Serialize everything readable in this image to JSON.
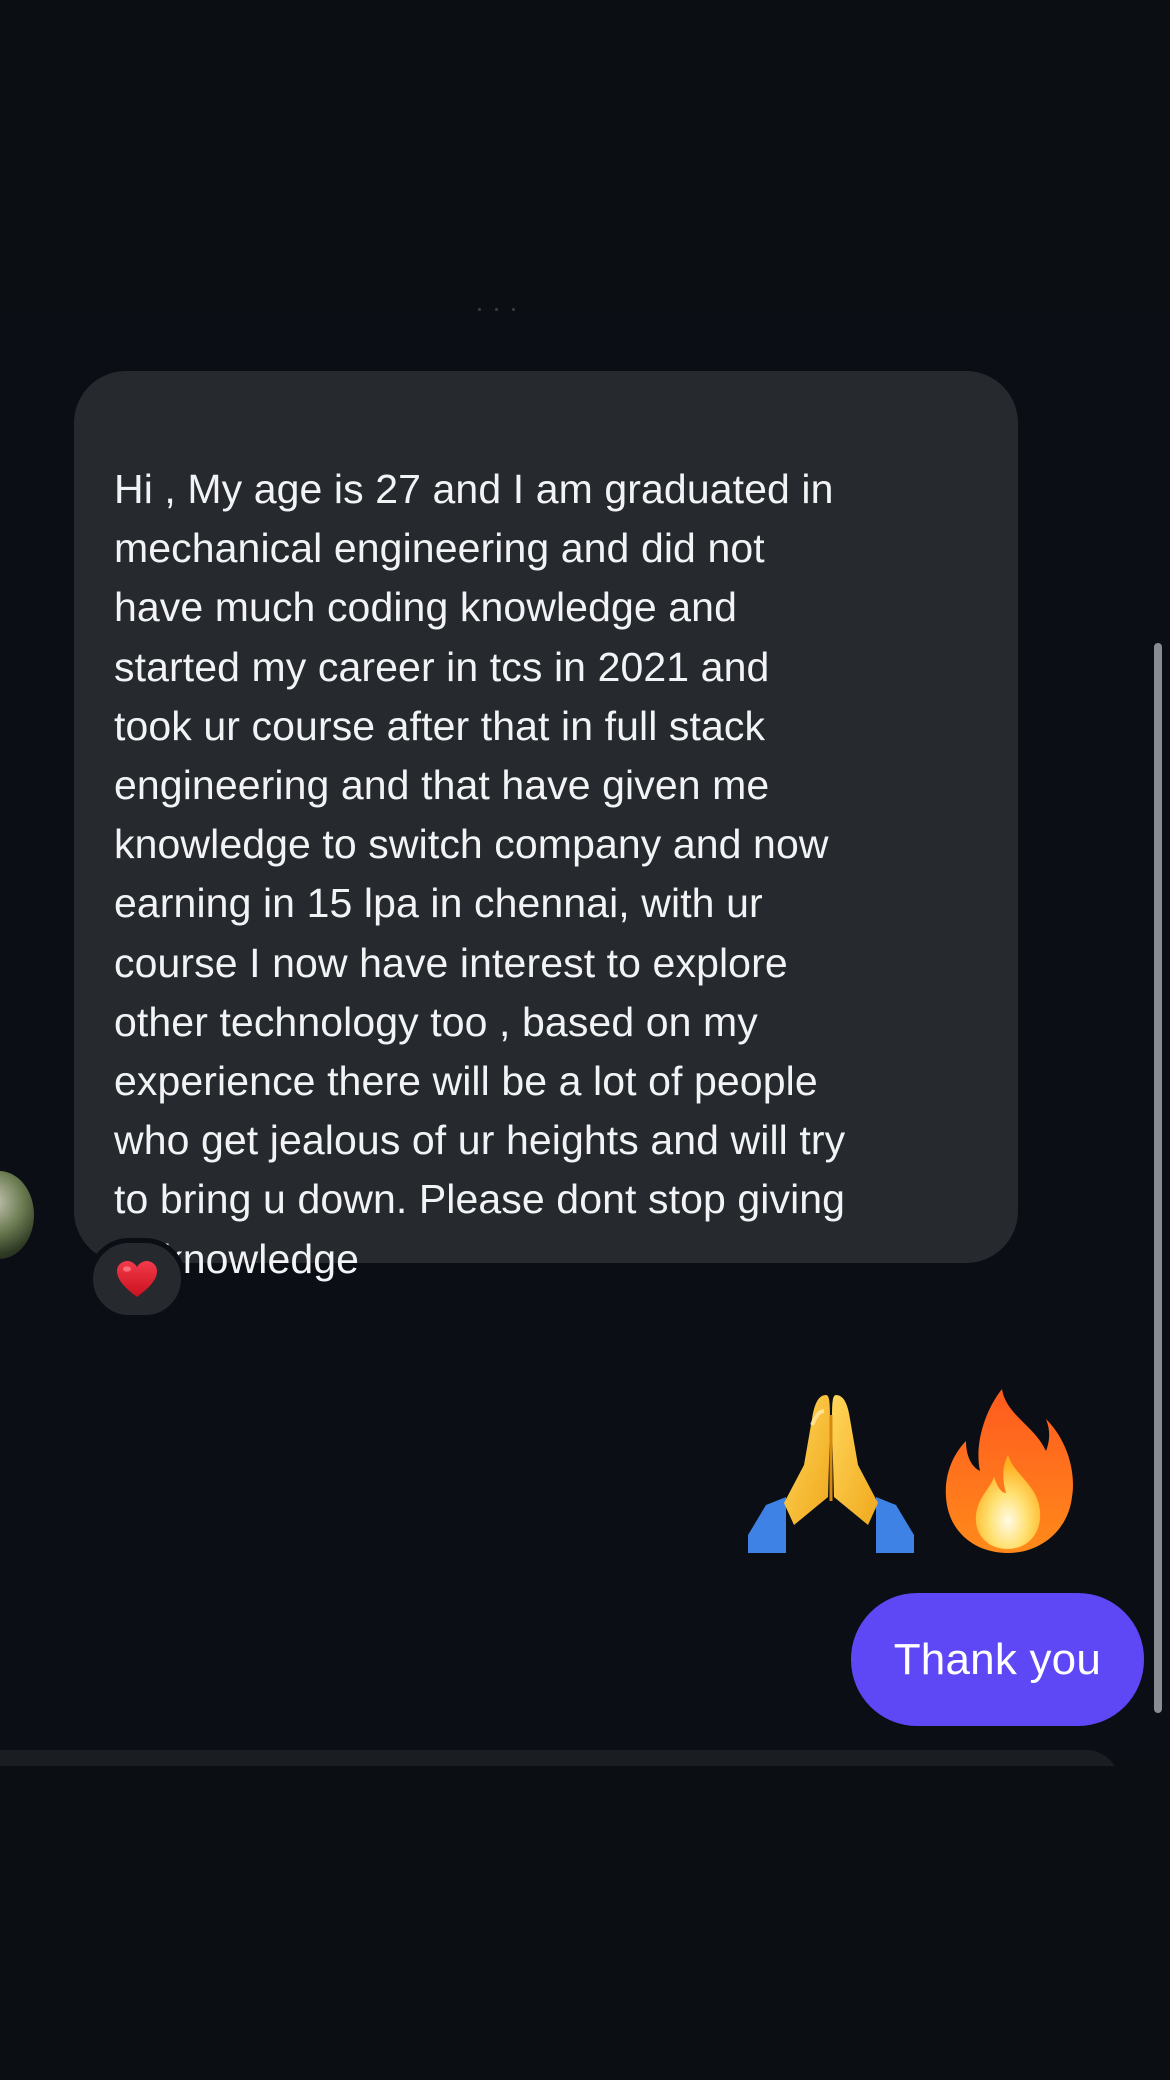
{
  "conversation": {
    "incoming_message": "Hi , My age is 27 and I am graduated in\nmechanical engineering and did not\nhave much coding knowledge and\nstarted my career in tcs in 2021 and\ntook ur course after that in full stack\nengineering and that have given me\nknowledge to switch company and now\nearning in 15 lpa in chennai, with ur\ncourse I now have interest to explore\nother technology too , based on my\nexperience there will be a lot of people\nwho get jealous of ur heights and will try\nto bring u down. Please dont stop giving\nur knowledge",
    "incoming_reaction": "heart-icon",
    "outgoing_emojis": [
      "folded-hands-icon",
      "fire-icon"
    ],
    "outgoing_message": "Thank you"
  },
  "colors": {
    "background": "#0b0e14",
    "incoming_bubble": "#26292e",
    "outgoing_bubble": "#5e47f5",
    "text": "#f2f3f5",
    "heart": "#e0202e"
  }
}
